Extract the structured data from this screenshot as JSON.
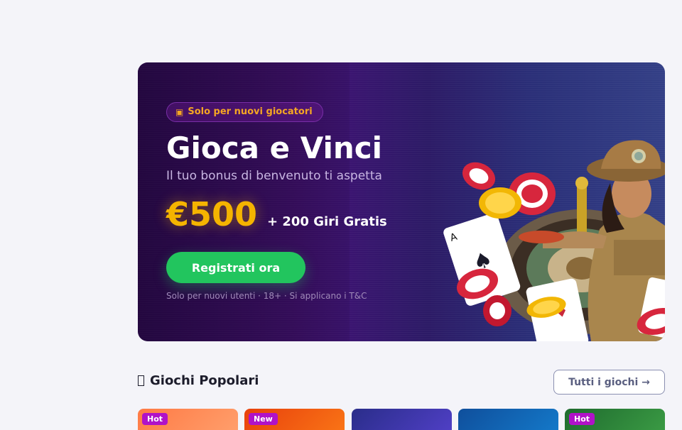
{
  "hero": {
    "badge_icon": "gift-icon",
    "badge": "Solo per nuovi giocatori",
    "title": "Gioca e Vinci",
    "subtitle": "Il tuo bonus di benvenuto ti aspetta",
    "amount": "€500",
    "spins": "+ 200 Giri Gratis",
    "cta_label": "Registrati ora",
    "disclaimer": "Solo per nuovi utenti · 18+ · Si applicano i T&C",
    "art_icon": "casino-adventurer-illustration"
  },
  "games_section": {
    "icon": "fire-icon",
    "title": "Giochi Popolari",
    "all_label": "Tutti i giochi →",
    "cards": [
      {
        "tag": "Hot",
        "color_from": "#ff7a45",
        "color_to": "#ff9e6b"
      },
      {
        "tag": "New",
        "color_from": "#e8410c",
        "color_to": "#f97316"
      },
      {
        "tag": "",
        "color_from": "#2a2d8a",
        "color_to": "#4f3fc4"
      },
      {
        "tag": "",
        "color_from": "#0f4f9c",
        "color_to": "#1478c8"
      },
      {
        "tag": "Hot",
        "color_from": "#1f6b2e",
        "color_to": "#3a9a44"
      }
    ]
  },
  "colors": {
    "accent_gold": "#f5b400",
    "cta_green": "#22c55e",
    "badge_purple": "#b012c8"
  }
}
